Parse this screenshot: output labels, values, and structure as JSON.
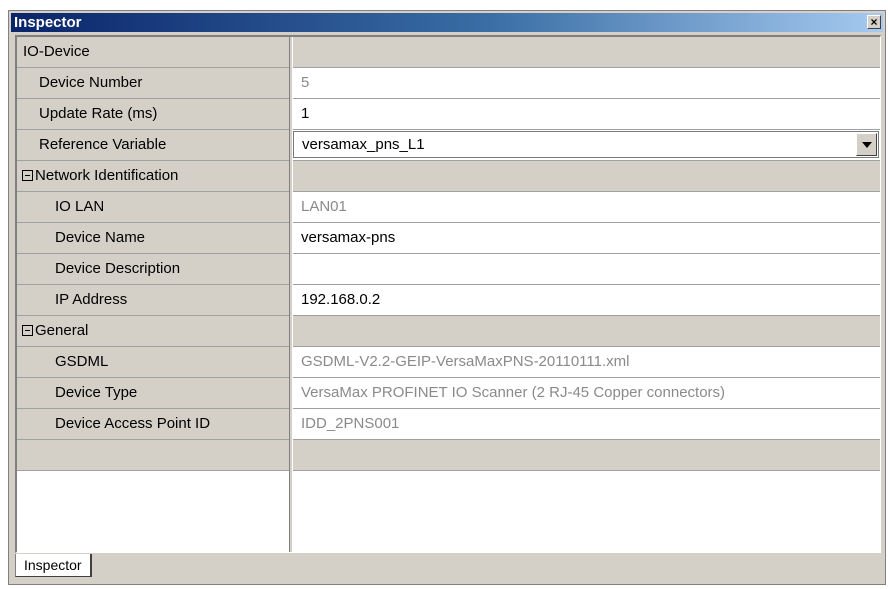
{
  "window": {
    "title": "Inspector",
    "close_glyph": "×"
  },
  "grid": {
    "device": {
      "label": "IO-Device"
    },
    "device_number": {
      "label": "Device Number",
      "value": "5"
    },
    "update_rate": {
      "label": "Update Rate (ms)",
      "value": "1"
    },
    "reference_variable": {
      "label": "Reference Variable",
      "value": "versamax_pns_L1"
    },
    "network_identification": {
      "label": "Network Identification",
      "expand_state": "expanded"
    },
    "io_lan": {
      "label": "IO LAN",
      "value": "LAN01"
    },
    "device_name": {
      "label": "Device Name",
      "value": "versamax-pns"
    },
    "device_description": {
      "label": "Device Description",
      "value": ""
    },
    "ip_address": {
      "label": "IP Address",
      "value": "192.168.0.2"
    },
    "general": {
      "label": "General",
      "expand_state": "expanded"
    },
    "gsdml": {
      "label": "GSDML",
      "value": "GSDML-V2.2-GEIP-VersaMaxPNS-20110111.xml"
    },
    "device_type": {
      "label": "Device Type",
      "value": "VersaMax PROFINET IO Scanner  (2 RJ-45 Copper connectors)"
    },
    "device_access_point_id": {
      "label": "Device Access Point ID",
      "value": "IDD_2PNS001"
    }
  },
  "tabs": [
    {
      "label": "Inspector"
    }
  ]
}
